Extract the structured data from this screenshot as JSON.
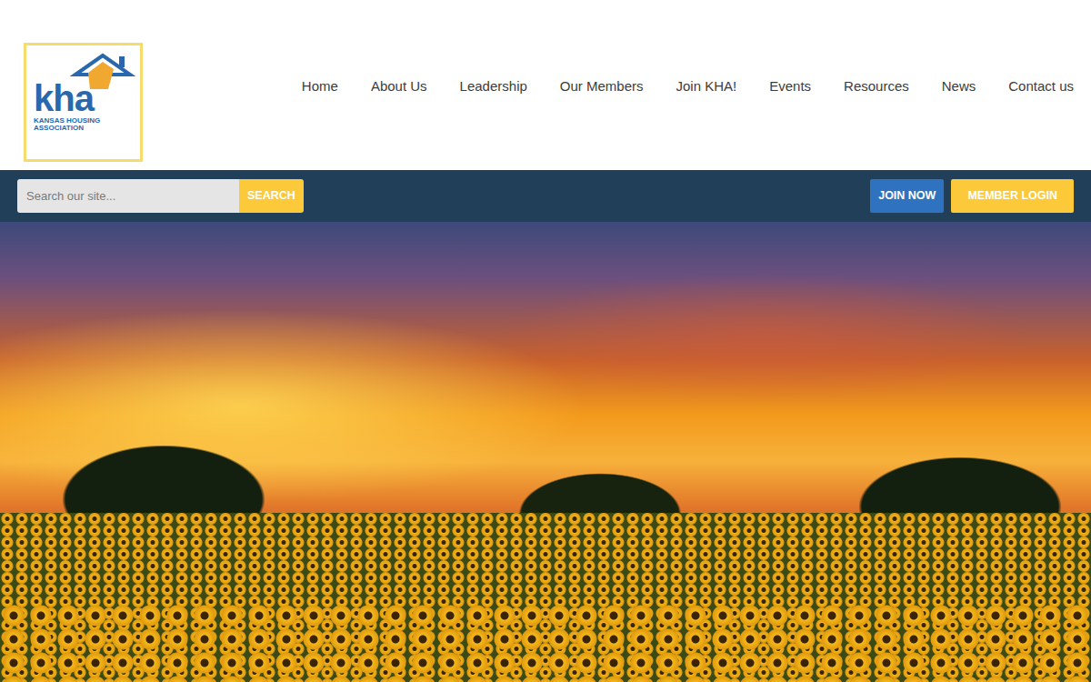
{
  "logo": {
    "mark": "kha",
    "name": "KANSAS HOUSING ASSOCIATION"
  },
  "nav": [
    "Home",
    "About Us",
    "Leadership",
    "Our Members",
    "Join KHA!",
    "Events",
    "Resources",
    "News",
    "Contact us"
  ],
  "search": {
    "placeholder": "Search our site...",
    "button": "SEARCH"
  },
  "actions": [
    "JOIN NOW",
    "MEMBER LOGIN"
  ]
}
